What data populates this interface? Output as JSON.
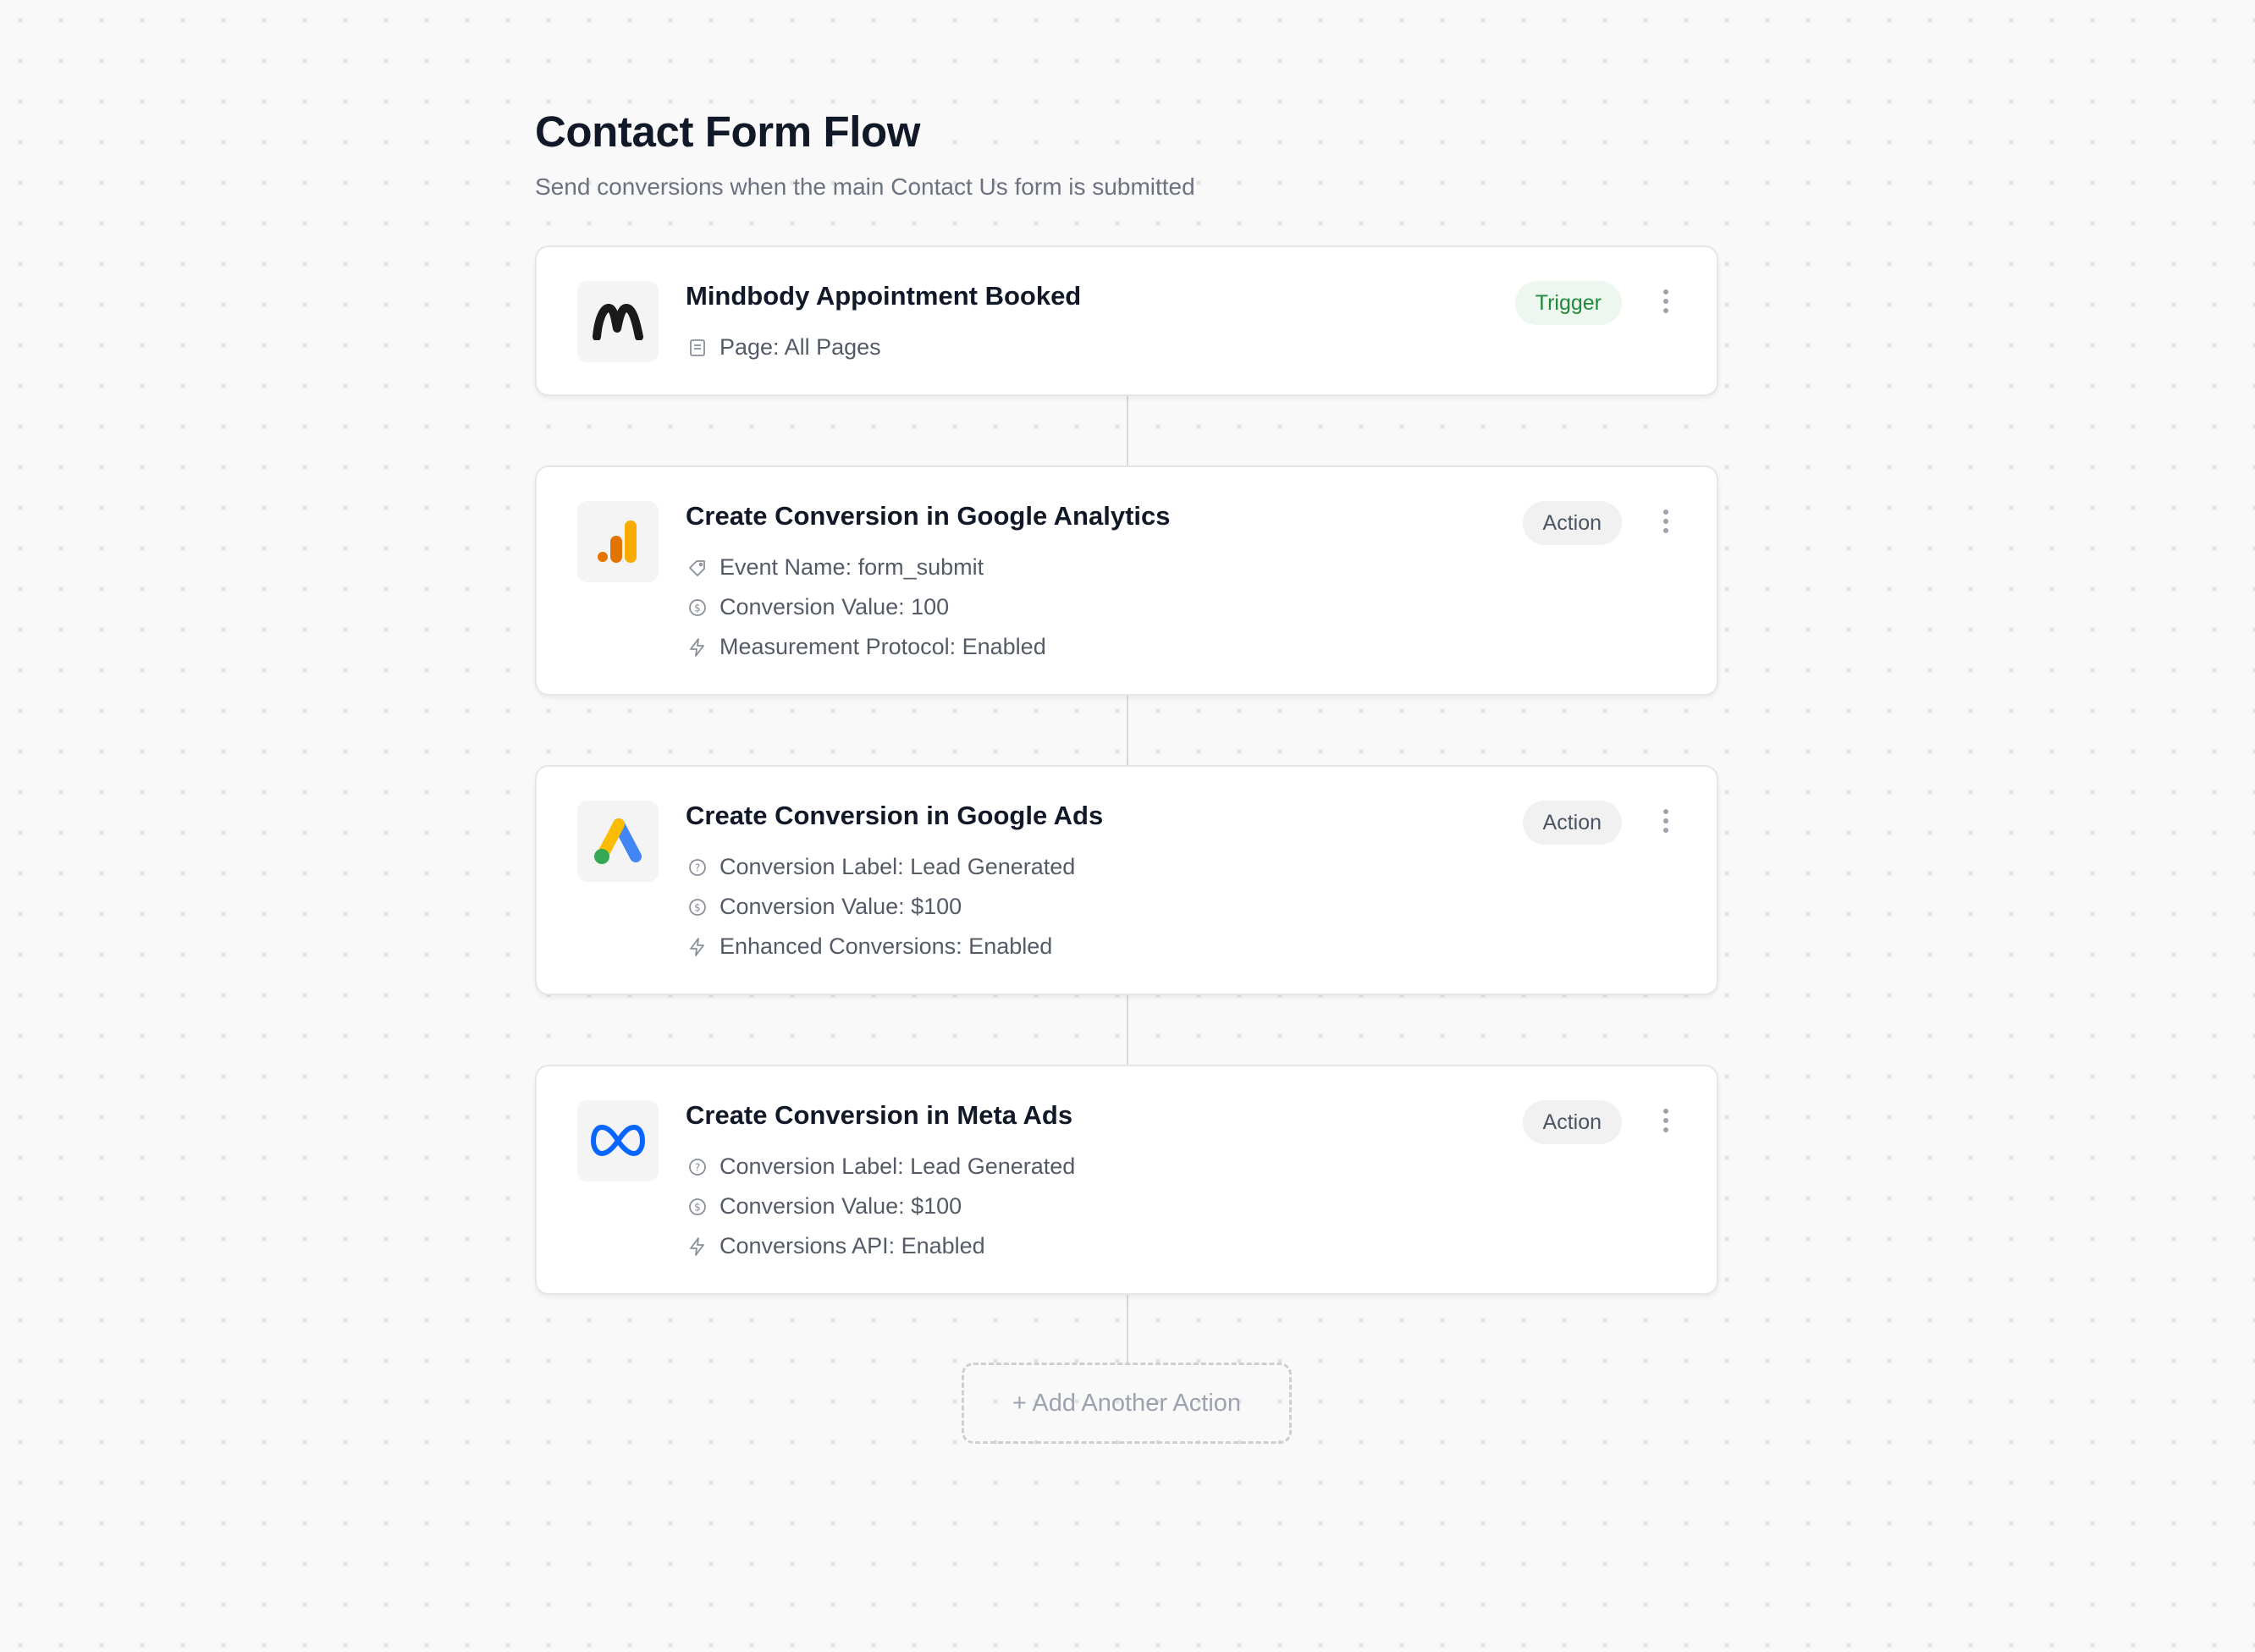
{
  "header": {
    "title": "Contact Form Flow",
    "subtitle": "Send conversions when the main Contact Us form is submitted"
  },
  "colors": {
    "trigger_badge_text": "#1f8a3b",
    "trigger_badge_bg": "#eef7ef",
    "action_badge_bg": "#f1f1f1",
    "google_analytics_orange": "#F9AB00",
    "google_analytics_dark_orange": "#E37400",
    "google_ads_blue": "#4285F4",
    "google_ads_yellow": "#FBBC04",
    "google_ads_green": "#34A853",
    "meta_blue": "#0866FF",
    "mindbody_dark": "#1a1a1a"
  },
  "steps": [
    {
      "logo": "mindbody-logo",
      "title": "Mindbody Appointment Booked",
      "badge": "Trigger",
      "details": [
        {
          "icon": "page-icon",
          "text": "Page: All Pages"
        }
      ]
    },
    {
      "logo": "google-analytics-logo",
      "title": "Create Conversion in Google Analytics",
      "badge": "Action",
      "details": [
        {
          "icon": "tag-icon",
          "text": "Event Name: form_submit"
        },
        {
          "icon": "dollar-circle-icon",
          "text": "Conversion Value: 100"
        },
        {
          "icon": "bolt-icon",
          "text": "Measurement Protocol: Enabled"
        }
      ]
    },
    {
      "logo": "google-ads-logo",
      "title": "Create Conversion in Google Ads",
      "badge": "Action",
      "details": [
        {
          "icon": "help-circle-icon",
          "text": "Conversion Label: Lead Generated"
        },
        {
          "icon": "dollar-circle-icon",
          "text": "Conversion Value: $100"
        },
        {
          "icon": "bolt-icon",
          "text": "Enhanced Conversions: Enabled"
        }
      ]
    },
    {
      "logo": "meta-logo",
      "title": "Create Conversion in Meta Ads",
      "badge": "Action",
      "details": [
        {
          "icon": "help-circle-icon",
          "text": "Conversion Label: Lead Generated"
        },
        {
          "icon": "dollar-circle-icon",
          "text": "Conversion Value: $100"
        },
        {
          "icon": "bolt-icon",
          "text": "Conversions API: Enabled"
        }
      ]
    }
  ],
  "add_action_label": "+ Add Another Action"
}
